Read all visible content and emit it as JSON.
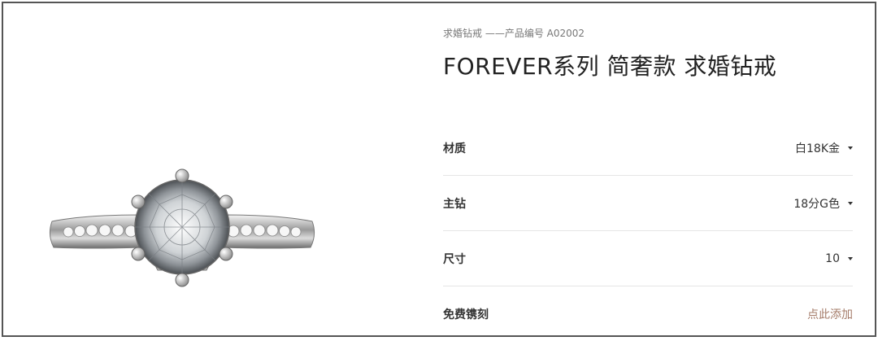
{
  "product": {
    "breadcrumb": "求婚钻戒 ——产品编号 A02002",
    "title": "FOREVER系列 简奢款 求婚钻戒",
    "image_alt": "diamond-ring-image"
  },
  "options": [
    {
      "label": "材质",
      "value": "白18K金",
      "icon": "caret-down-icon"
    },
    {
      "label": "主钻",
      "value": "18分G色",
      "icon": "caret-down-icon"
    },
    {
      "label": "尺寸",
      "value": "10",
      "icon": "caret-down-icon"
    }
  ],
  "engraving": {
    "label": "免费镌刻",
    "link": "点此添加"
  },
  "colors": {
    "link_accent": "#a57c6a",
    "frame_border": "#555555",
    "divider": "#e5e5e5"
  }
}
